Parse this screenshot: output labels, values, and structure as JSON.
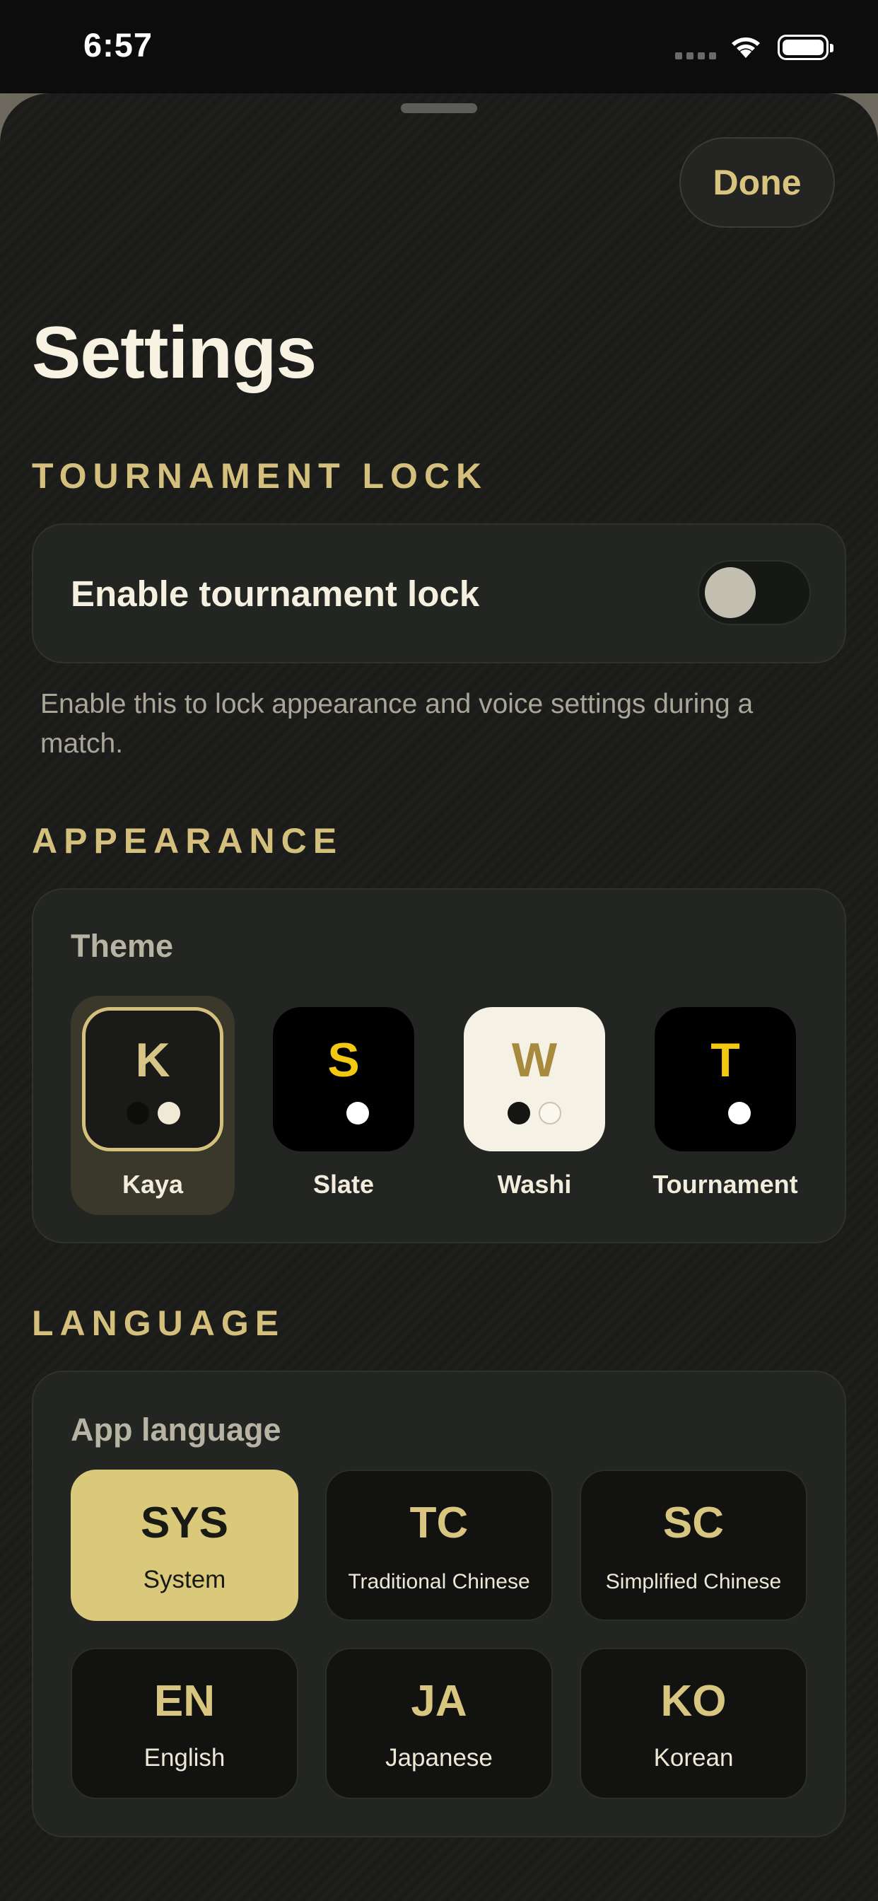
{
  "status_bar": {
    "time": "6:57"
  },
  "sheet": {
    "done_label": "Done",
    "title": "Settings"
  },
  "tournament_lock": {
    "header": "TOURNAMENT LOCK",
    "toggle_label": "Enable tournament lock",
    "toggle_on": false,
    "footnote": "Enable this to lock appearance and voice settings during a match."
  },
  "appearance": {
    "header": "APPEARANCE",
    "theme_label": "Theme",
    "themes": [
      {
        "letter": "K",
        "name": "Kaya",
        "selected": true
      },
      {
        "letter": "S",
        "name": "Slate",
        "selected": false
      },
      {
        "letter": "W",
        "name": "Washi",
        "selected": false
      },
      {
        "letter": "T",
        "name": "Tournament",
        "selected": false
      }
    ]
  },
  "language": {
    "header": "LANGUAGE",
    "label": "App language",
    "options": [
      {
        "code": "SYS",
        "name": "System",
        "selected": true
      },
      {
        "code": "TC",
        "name": "Traditional Chinese",
        "selected": false
      },
      {
        "code": "SC",
        "name": "Simplified Chinese",
        "selected": false
      },
      {
        "code": "EN",
        "name": "English",
        "selected": false
      },
      {
        "code": "JA",
        "name": "Japanese",
        "selected": false
      },
      {
        "code": "KO",
        "name": "Korean",
        "selected": false
      }
    ]
  },
  "colors": {
    "accent_gold": "#d4c07c",
    "selected_language_bg": "#dac97b",
    "background": "#1e1f1d"
  }
}
